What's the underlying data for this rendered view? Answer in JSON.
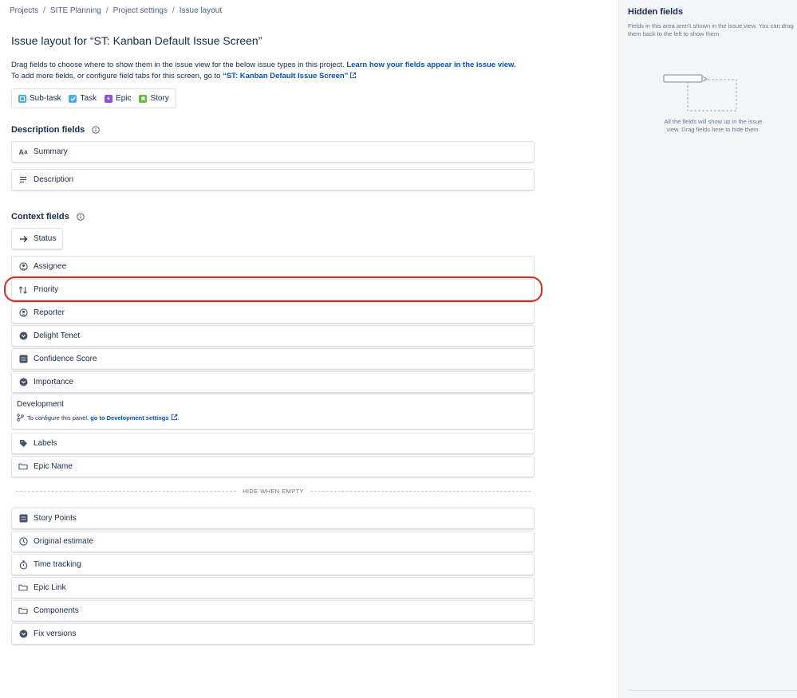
{
  "breadcrumb": [
    {
      "label": "Projects"
    },
    {
      "label": "SITE Planning"
    },
    {
      "label": "Project settings"
    },
    {
      "label": "Issue layout"
    }
  ],
  "breadcrumb_separator": "/",
  "page_title": "Issue layout for “ST: Kanban Default Issue Screen”",
  "intro": {
    "line1_text": "Drag fields to choose where to show them in the issue view for the below issue types in this project. ",
    "line1_link": "Learn how your fields appear in the issue view.",
    "line2_text": "To add more fields, or configure field tabs for this screen, go to ",
    "line2_link": "“ST: Kanban Default Issue Screen”"
  },
  "issue_types": [
    {
      "label": "Sub-task",
      "color": "#4bade8",
      "icon": "subtask-icon"
    },
    {
      "label": "Task",
      "color": "#4bade8",
      "icon": "task-icon"
    },
    {
      "label": "Epic",
      "color": "#904ee2",
      "icon": "epic-icon"
    },
    {
      "label": "Story",
      "color": "#63ba3c",
      "icon": "story-icon"
    }
  ],
  "description_section": {
    "title": "Description fields",
    "fields": [
      {
        "label": "Summary",
        "icon": "text-format-icon"
      },
      {
        "label": "Description",
        "icon": "lines-icon"
      }
    ]
  },
  "context_section": {
    "title": "Context fields",
    "status": {
      "label": "Status",
      "icon": "arrow-right-icon"
    },
    "fields_before_dev": [
      {
        "label": "Assignee",
        "icon": "person-icon"
      },
      {
        "label": "Priority",
        "icon": "priority-arrows-icon",
        "highlighted": true
      },
      {
        "label": "Reporter",
        "icon": "person-icon"
      },
      {
        "label": "Delight Tenet",
        "icon": "chevron-circle-icon"
      },
      {
        "label": "Confidence Score",
        "icon": "number-icon"
      },
      {
        "label": "Importance",
        "icon": "chevron-circle-icon"
      }
    ],
    "development": {
      "title": "Development",
      "text": "To configure this panel, ",
      "link": "go to Development settings",
      "suffix": "."
    },
    "fields_after_dev": [
      {
        "label": "Labels",
        "icon": "tag-icon"
      },
      {
        "label": "Epic Name",
        "icon": "field-box-icon"
      }
    ],
    "divider_label": "HIDE WHEN EMPTY",
    "hide_when_empty_fields": [
      {
        "label": "Story Points",
        "icon": "number-icon"
      },
      {
        "label": "Original estimate",
        "icon": "clock-icon"
      },
      {
        "label": "Time tracking",
        "icon": "stopwatch-icon"
      },
      {
        "label": "Epic Link",
        "icon": "field-box-icon"
      },
      {
        "label": "Components",
        "icon": "field-box-icon"
      },
      {
        "label": "Fix versions",
        "icon": "chevron-circle-icon"
      }
    ]
  },
  "hidden_fields": {
    "title": "Hidden fields",
    "description": "Fields in this area aren't shown in the issue view. You can drag them back to the left to show them.",
    "empty_text": "All the fields will show up in the issue view. Drag fields here to hide them."
  },
  "colors": {
    "link": "#0052cc",
    "highlight": "#e0281e",
    "panel_bg": "#f4f5f7"
  }
}
